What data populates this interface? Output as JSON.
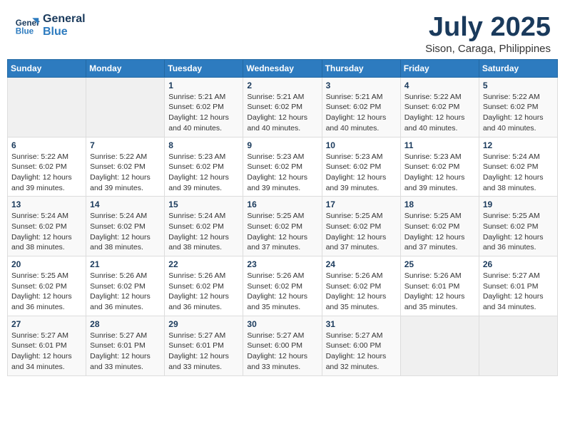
{
  "header": {
    "logo_line1": "General",
    "logo_line2": "Blue",
    "month_title": "July 2025",
    "subtitle": "Sison, Caraga, Philippines"
  },
  "weekdays": [
    "Sunday",
    "Monday",
    "Tuesday",
    "Wednesday",
    "Thursday",
    "Friday",
    "Saturday"
  ],
  "weeks": [
    [
      {
        "day": "",
        "sunrise": "",
        "sunset": "",
        "daylight": ""
      },
      {
        "day": "",
        "sunrise": "",
        "sunset": "",
        "daylight": ""
      },
      {
        "day": "1",
        "sunrise": "Sunrise: 5:21 AM",
        "sunset": "Sunset: 6:02 PM",
        "daylight": "Daylight: 12 hours and 40 minutes."
      },
      {
        "day": "2",
        "sunrise": "Sunrise: 5:21 AM",
        "sunset": "Sunset: 6:02 PM",
        "daylight": "Daylight: 12 hours and 40 minutes."
      },
      {
        "day": "3",
        "sunrise": "Sunrise: 5:21 AM",
        "sunset": "Sunset: 6:02 PM",
        "daylight": "Daylight: 12 hours and 40 minutes."
      },
      {
        "day": "4",
        "sunrise": "Sunrise: 5:22 AM",
        "sunset": "Sunset: 6:02 PM",
        "daylight": "Daylight: 12 hours and 40 minutes."
      },
      {
        "day": "5",
        "sunrise": "Sunrise: 5:22 AM",
        "sunset": "Sunset: 6:02 PM",
        "daylight": "Daylight: 12 hours and 40 minutes."
      }
    ],
    [
      {
        "day": "6",
        "sunrise": "Sunrise: 5:22 AM",
        "sunset": "Sunset: 6:02 PM",
        "daylight": "Daylight: 12 hours and 39 minutes."
      },
      {
        "day": "7",
        "sunrise": "Sunrise: 5:22 AM",
        "sunset": "Sunset: 6:02 PM",
        "daylight": "Daylight: 12 hours and 39 minutes."
      },
      {
        "day": "8",
        "sunrise": "Sunrise: 5:23 AM",
        "sunset": "Sunset: 6:02 PM",
        "daylight": "Daylight: 12 hours and 39 minutes."
      },
      {
        "day": "9",
        "sunrise": "Sunrise: 5:23 AM",
        "sunset": "Sunset: 6:02 PM",
        "daylight": "Daylight: 12 hours and 39 minutes."
      },
      {
        "day": "10",
        "sunrise": "Sunrise: 5:23 AM",
        "sunset": "Sunset: 6:02 PM",
        "daylight": "Daylight: 12 hours and 39 minutes."
      },
      {
        "day": "11",
        "sunrise": "Sunrise: 5:23 AM",
        "sunset": "Sunset: 6:02 PM",
        "daylight": "Daylight: 12 hours and 39 minutes."
      },
      {
        "day": "12",
        "sunrise": "Sunrise: 5:24 AM",
        "sunset": "Sunset: 6:02 PM",
        "daylight": "Daylight: 12 hours and 38 minutes."
      }
    ],
    [
      {
        "day": "13",
        "sunrise": "Sunrise: 5:24 AM",
        "sunset": "Sunset: 6:02 PM",
        "daylight": "Daylight: 12 hours and 38 minutes."
      },
      {
        "day": "14",
        "sunrise": "Sunrise: 5:24 AM",
        "sunset": "Sunset: 6:02 PM",
        "daylight": "Daylight: 12 hours and 38 minutes."
      },
      {
        "day": "15",
        "sunrise": "Sunrise: 5:24 AM",
        "sunset": "Sunset: 6:02 PM",
        "daylight": "Daylight: 12 hours and 38 minutes."
      },
      {
        "day": "16",
        "sunrise": "Sunrise: 5:25 AM",
        "sunset": "Sunset: 6:02 PM",
        "daylight": "Daylight: 12 hours and 37 minutes."
      },
      {
        "day": "17",
        "sunrise": "Sunrise: 5:25 AM",
        "sunset": "Sunset: 6:02 PM",
        "daylight": "Daylight: 12 hours and 37 minutes."
      },
      {
        "day": "18",
        "sunrise": "Sunrise: 5:25 AM",
        "sunset": "Sunset: 6:02 PM",
        "daylight": "Daylight: 12 hours and 37 minutes."
      },
      {
        "day": "19",
        "sunrise": "Sunrise: 5:25 AM",
        "sunset": "Sunset: 6:02 PM",
        "daylight": "Daylight: 12 hours and 36 minutes."
      }
    ],
    [
      {
        "day": "20",
        "sunrise": "Sunrise: 5:25 AM",
        "sunset": "Sunset: 6:02 PM",
        "daylight": "Daylight: 12 hours and 36 minutes."
      },
      {
        "day": "21",
        "sunrise": "Sunrise: 5:26 AM",
        "sunset": "Sunset: 6:02 PM",
        "daylight": "Daylight: 12 hours and 36 minutes."
      },
      {
        "day": "22",
        "sunrise": "Sunrise: 5:26 AM",
        "sunset": "Sunset: 6:02 PM",
        "daylight": "Daylight: 12 hours and 36 minutes."
      },
      {
        "day": "23",
        "sunrise": "Sunrise: 5:26 AM",
        "sunset": "Sunset: 6:02 PM",
        "daylight": "Daylight: 12 hours and 35 minutes."
      },
      {
        "day": "24",
        "sunrise": "Sunrise: 5:26 AM",
        "sunset": "Sunset: 6:02 PM",
        "daylight": "Daylight: 12 hours and 35 minutes."
      },
      {
        "day": "25",
        "sunrise": "Sunrise: 5:26 AM",
        "sunset": "Sunset: 6:01 PM",
        "daylight": "Daylight: 12 hours and 35 minutes."
      },
      {
        "day": "26",
        "sunrise": "Sunrise: 5:27 AM",
        "sunset": "Sunset: 6:01 PM",
        "daylight": "Daylight: 12 hours and 34 minutes."
      }
    ],
    [
      {
        "day": "27",
        "sunrise": "Sunrise: 5:27 AM",
        "sunset": "Sunset: 6:01 PM",
        "daylight": "Daylight: 12 hours and 34 minutes."
      },
      {
        "day": "28",
        "sunrise": "Sunrise: 5:27 AM",
        "sunset": "Sunset: 6:01 PM",
        "daylight": "Daylight: 12 hours and 33 minutes."
      },
      {
        "day": "29",
        "sunrise": "Sunrise: 5:27 AM",
        "sunset": "Sunset: 6:01 PM",
        "daylight": "Daylight: 12 hours and 33 minutes."
      },
      {
        "day": "30",
        "sunrise": "Sunrise: 5:27 AM",
        "sunset": "Sunset: 6:00 PM",
        "daylight": "Daylight: 12 hours and 33 minutes."
      },
      {
        "day": "31",
        "sunrise": "Sunrise: 5:27 AM",
        "sunset": "Sunset: 6:00 PM",
        "daylight": "Daylight: 12 hours and 32 minutes."
      },
      {
        "day": "",
        "sunrise": "",
        "sunset": "",
        "daylight": ""
      },
      {
        "day": "",
        "sunrise": "",
        "sunset": "",
        "daylight": ""
      }
    ]
  ]
}
